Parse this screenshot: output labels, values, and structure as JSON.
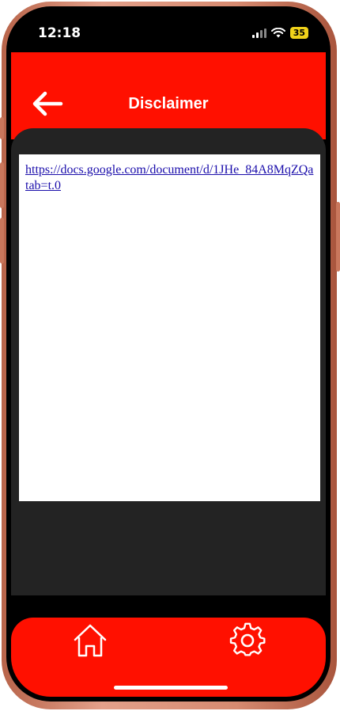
{
  "status_bar": {
    "time": "12:18",
    "battery": "35",
    "signal_icon": "cellular-signal-icon",
    "wifi_icon": "wifi-icon"
  },
  "header": {
    "title": "Disclaimer",
    "back_icon": "arrow-left-icon"
  },
  "document": {
    "link_text": "https://docs.google.com/document/d/1JHe_84A8MqZQa\ntab=t.0"
  },
  "bottom_nav": {
    "home_icon": "home-icon",
    "settings_icon": "gear-icon"
  },
  "colors": {
    "accent": "#ff1000",
    "content_bg": "#232323",
    "link": "#1a0dab"
  }
}
